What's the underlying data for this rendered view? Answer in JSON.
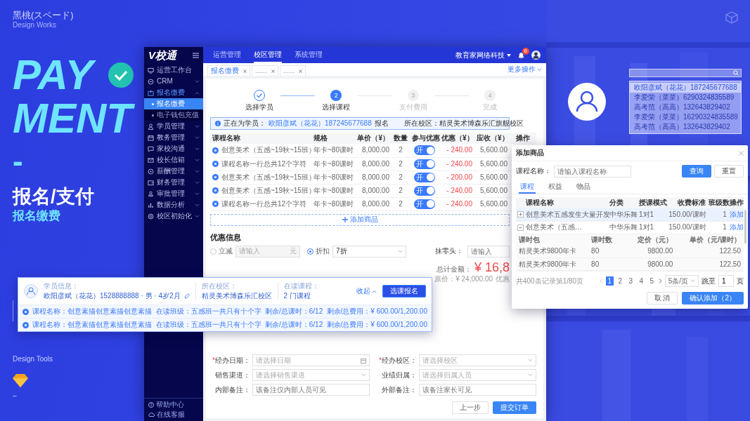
{
  "showcase": {
    "author": "黑桃(スペード)",
    "series": "Design Works",
    "headline": [
      "PAY",
      "MENT"
    ],
    "dash": "-",
    "title": "报名/支付",
    "subtitle": "报名缴费",
    "tools_label": "Design Tools",
    "tools_dash": "–"
  },
  "app": {
    "logo": "V校通",
    "nav": [
      {
        "label": "运营管理",
        "selected": false
      },
      {
        "label": "校区管理",
        "selected": true
      },
      {
        "label": "系统管理",
        "selected": false
      }
    ],
    "company": "教育家网络科技",
    "notifications": "6",
    "sidebar": {
      "items": [
        {
          "label": "运营工作台",
          "selected": false
        },
        {
          "label": "CRM",
          "selected": false,
          "expanded": false
        },
        {
          "label": "报名缴费",
          "selected": true,
          "expanded": true,
          "children": [
            {
              "label": "报名缴费",
              "selected": true
            },
            {
              "label": "电子钱包充值",
              "selected": false
            }
          ]
        },
        {
          "label": "学员管理",
          "selected": false,
          "expanded": false
        },
        {
          "label": "教务管理",
          "selected": false,
          "expanded": false
        },
        {
          "label": "家校沟通",
          "selected": false,
          "expanded": false
        },
        {
          "label": "校长信箱",
          "selected": false,
          "expanded": false
        },
        {
          "label": "薪酬管理",
          "selected": false,
          "expanded": false
        },
        {
          "label": "财务管理",
          "selected": false,
          "expanded": false
        },
        {
          "label": "审批管理",
          "selected": false,
          "expanded": false
        },
        {
          "label": "数据分析",
          "selected": false,
          "expanded": false
        },
        {
          "label": "校区初始化",
          "selected": false,
          "expanded": false
        }
      ],
      "footer": [
        "帮助中心",
        "在线客服"
      ]
    },
    "tabs": [
      {
        "label": "报名缴费",
        "selected": true
      },
      {
        "label": "......",
        "selected": false
      },
      {
        "label": "......",
        "selected": false
      }
    ],
    "more_actions": "更多操作",
    "steps": [
      {
        "label": "选择学员",
        "completed": true,
        "current": false
      },
      {
        "number": "2",
        "label": "选择课程",
        "completed": false,
        "current": true
      },
      {
        "number": "3",
        "label": "支付费用",
        "completed": false,
        "current": false
      },
      {
        "number": "4",
        "label": "完成",
        "completed": false,
        "current": false
      }
    ],
    "banner": {
      "prefix": "正在为学员：",
      "student": "欧阳彦斌（花花）187245677688",
      "suffix": "报名",
      "campus": "所在校区：精灵美术博森乐汇旗舰校区"
    },
    "table": {
      "columns": [
        "课程名称",
        "规格",
        "单价（¥）",
        "数量",
        "参与优惠",
        "优惠（¥）",
        "应收（¥）",
        "操作"
      ],
      "rows": [
        {
          "name": "创意美术（五感~19秋~15班）",
          "spec": "年卡~80课时",
          "price": "8,000.00",
          "qty": "2",
          "switch_on": true,
          "switch_label": "开",
          "discount": "- 240.00",
          "due": "5,600.00"
        },
        {
          "name": "课程名称一行总共12个字符",
          "spec": "年卡~80课时",
          "price": "8,000.00",
          "qty": "2",
          "switch_on": true,
          "switch_label": "开",
          "discount": "- 240.00",
          "due": "5,600.00"
        },
        {
          "name": "创意美术（五感~19秋~15班）",
          "spec": "年卡~80课时",
          "price": "8,000.00",
          "qty": "2",
          "switch_on": true,
          "switch_label": "开",
          "discount": "- 200.00",
          "due": "5,600.00"
        },
        {
          "name": "创意美术（五感~19秋~15班）",
          "spec": "年卡~80课时",
          "price": "8,000.00",
          "qty": "2",
          "switch_on": true,
          "switch_label": "开",
          "discount": "- 240.00",
          "due": "5,600.00"
        },
        {
          "name": "课程名称一行总共12个字符",
          "spec": "年卡~80课时",
          "price": "8,000.00",
          "qty": "2",
          "switch_on": true,
          "switch_label": "开",
          "discount": "- 240.00",
          "due": "5,600.00"
        }
      ]
    },
    "add_button": "添加商品",
    "discount": {
      "title": "优惠信息",
      "options": [
        {
          "kind": "amount",
          "label": "立减",
          "selected": false,
          "disabled": true,
          "placeholder": "请输入",
          "unit": "元"
        },
        {
          "kind": "select",
          "label": "折扣",
          "selected": true,
          "value": "7折"
        }
      ],
      "round_label": "抹零头：",
      "round_placeholder": "请输入"
    },
    "totals": {
      "label": "总计金额：",
      "amount": "¥ 16,8",
      "original": "原价：¥ 24,000.00",
      "discount_label": "优惠"
    },
    "form": {
      "fields": [
        {
          "kind": "date",
          "marker": "*",
          "label": "经办日期：",
          "placeholder": "请选择日期"
        },
        {
          "kind": "select",
          "marker": "*",
          "label": "经办校区：",
          "placeholder": "请选择校区"
        },
        {
          "kind": "select",
          "label": "销售渠道：",
          "placeholder": "请选择销售渠道"
        },
        {
          "kind": "select",
          "label": "业绩归属：",
          "placeholder": "请选择归属人员"
        },
        {
          "kind": "text",
          "label": "内部备注：",
          "placeholder": "该备注仅内部人员可见"
        },
        {
          "kind": "text",
          "label": "外部备注：",
          "placeholder": "该备注家长可见"
        }
      ],
      "buttons": [
        {
          "kind": "default",
          "label": "上一步"
        },
        {
          "kind": "primary",
          "label": "提交订单"
        }
      ]
    }
  },
  "student_card": {
    "label": "学员信息：",
    "name": "欧阳彦斌（花花）1528888888 · 男 · 4岁2月",
    "campus_label": "所在校区：",
    "campus": "精灵美术博森乐汇校区",
    "courses_label": "在读课程：",
    "courses": "2 门课程",
    "collapse": "收起",
    "action": "选课报名",
    "rows": [
      {
        "course": "课程名称：创意素描创意素描创意素描",
        "class": "在读班级：五感班一共只有十个字",
        "hours": "剩余/总课时：6/12",
        "fee": "剩余/总费用：¥ 600.00/1,200.00"
      },
      {
        "course": "课程名称：创意素描创意素描创意素描",
        "class": "在读班级：五感班一共只有十个字",
        "hours": "剩余/总课时：6/12",
        "fee": "剩余/总费用：¥ 600.00/1,200.00"
      }
    ]
  },
  "dialog": {
    "title": "添加商品",
    "search_label": "课程名称：",
    "search_placeholder": "请输入课程名称",
    "search_button": "查询",
    "reset_button": "重置",
    "tabs": [
      {
        "label": "课程",
        "selected": true
      },
      {
        "label": "权益",
        "selected": false
      },
      {
        "label": "物品",
        "selected": false
      }
    ],
    "columns": [
      "课程名称",
      "分类",
      "授课模式",
      "收费标准",
      "班级数",
      "操作"
    ],
    "rows": [
      {
        "expanded": false,
        "selected": true,
        "name": "创意美术五感发生大量开发",
        "category": "中华乐舞",
        "mode": "1对1",
        "fee": "150.00/课时",
        "classes": "1",
        "action": "添加"
      },
      {
        "expanded": true,
        "selected": false,
        "name": "创意美术（五感…",
        "category": "中华乐舞",
        "mode": "1对1",
        "fee": "150.00/课时",
        "classes": "1",
        "action": "添加",
        "sub_columns": [
          "课时包",
          "课时数",
          "定价（元）",
          "单价（元/课时）"
        ],
        "children": [
          {
            "package": "精灵美术9800年卡",
            "hours": "80",
            "list_price": "9800.00",
            "unit_price": "122.50"
          },
          {
            "package": "精灵美术9800年卡",
            "hours": "80",
            "list_price": "9800.00",
            "unit_price": "122.50"
          }
        ]
      }
    ],
    "total": "共400条记录第1/80页",
    "pages": [
      {
        "label": "1",
        "selected": true
      },
      {
        "label": "2",
        "selected": false
      },
      {
        "label": "3",
        "selected": false
      },
      {
        "label": "4",
        "selected": false
      },
      {
        "label": "5",
        "selected": false
      }
    ],
    "page_size": "5条/页",
    "jump_label": "跳至",
    "jump_value": "1",
    "jump_unit": "页",
    "cancel": "取 消",
    "confirm": "确认添加（2）"
  },
  "student_search": {
    "items": [
      {
        "label": "欧阳彦斌（花花）187245677688",
        "selected": true
      },
      {
        "label": "李爱荣（菜菜）6290324835589",
        "selected": false
      },
      {
        "label": "高考范（高高）132643829402",
        "selected": false
      },
      {
        "label": "李爱荣（菜菜）16290324835589",
        "selected": false
      },
      {
        "label": "高考范（高高）132643829402",
        "selected": false
      }
    ]
  }
}
